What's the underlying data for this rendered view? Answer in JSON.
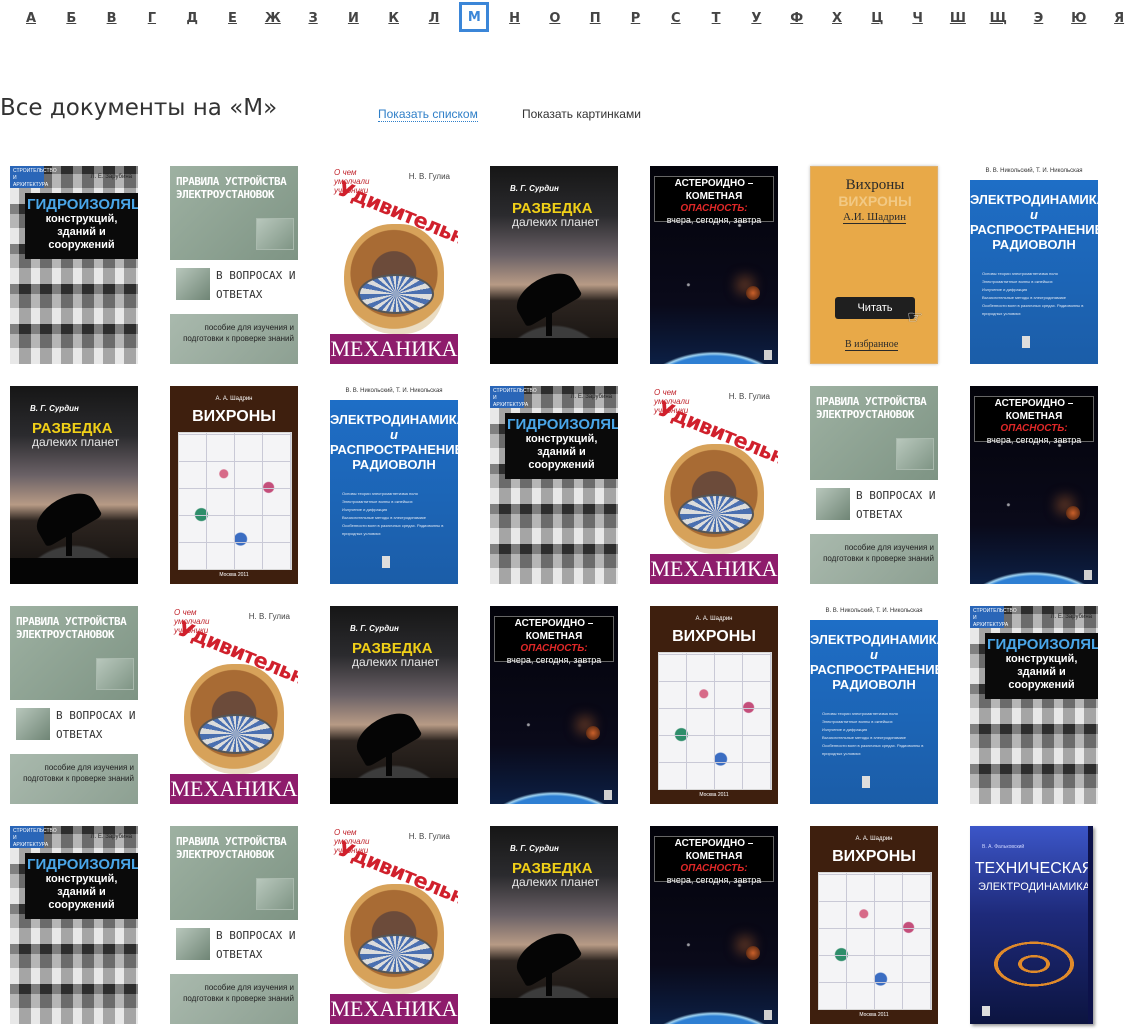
{
  "alphabet": {
    "letters": [
      "А",
      "Б",
      "В",
      "Г",
      "Д",
      "Е",
      "Ж",
      "З",
      "И",
      "К",
      "Л",
      "М",
      "Н",
      "О",
      "П",
      "Р",
      "С",
      "Т",
      "У",
      "Ф",
      "Х",
      "Ц",
      "Ч",
      "Ш",
      "Щ",
      "Э",
      "Ю",
      "Я"
    ],
    "active": "М"
  },
  "heading": {
    "title": "Все документы на «М»",
    "show_list": "Показать списком",
    "show_pictures": "Показать картинками"
  },
  "hover": {
    "read_button": "Читать",
    "favorite_link": "В избранное"
  },
  "covers": {
    "gidro": {
      "series": "СТРОИТЕЛЬСТВО И АРХИТЕКТУРА",
      "author": "Л. Е. Зарубина",
      "title_main": "ГИДРОИЗОЛЯЦИЯ",
      "title_rest": "конструкций, зданий и сооружений"
    },
    "pravila": {
      "title": "ПРАВИЛА УСТРОЙСТВА ЭЛЕКТРОУСТАНОВОК",
      "answers": "В ВОПРОСАХ И ОТВЕТАХ",
      "subtitle": "пособие для изучения и подготовки к проверке знаний"
    },
    "meh": {
      "series": "О чем умолчали учебники",
      "author": "Н. В. Гулиа",
      "title_arc": "Удивительная",
      "title_main": "МЕХАНИКА"
    },
    "razv": {
      "author": "В. Г. Сурдин",
      "title_main": "РАЗВЕДКА",
      "title_sub": "далеких планет"
    },
    "aster": {
      "line1": "АСТЕРОИДНО – КОМЕТНАЯ",
      "line2": "ОПАСНОСТЬ:",
      "line3": "вчера, сегодня, завтра"
    },
    "vihr": {
      "author": "А. А. Шадрин",
      "title": "ВИХРОНЫ",
      "hover_title": "Вихроны",
      "hover_author": "А.И. Шадрин",
      "city": "Москва 2011"
    },
    "electro": {
      "authors": "В. В. Никольский, Т. И. Никольская",
      "title1": "ЭЛЕКТРОДИНАМИКА",
      "title_and": "и",
      "title2": "РАСПРОСТРАНЕНИЕ",
      "title3": "РАДИОВОЛН",
      "items": [
        "Основы теории электромагнетизма поля",
        "Электромагнитные волны в окнейших",
        "Излучение и дифракция",
        "Вычислительные методы в электродинамике",
        "Особенности волн в различных средах. Радиоволны в природных условиях"
      ]
    },
    "tech": {
      "author": "В. А. Фальковский",
      "title1": "ТЕХНИЧЕСКАЯ",
      "title2": "ЭЛЕКТРОДИНАМИКА"
    }
  },
  "grid": {
    "rows": [
      [
        "gidro",
        "pravila",
        "meh",
        "razv",
        "aster",
        "vihr-hover",
        "electro"
      ],
      [
        "razv",
        "vihr",
        "electro",
        "gidro",
        "meh",
        "pravila",
        "aster"
      ],
      [
        "pravila",
        "meh",
        "razv",
        "aster",
        "vihr",
        "electro",
        "gidro"
      ],
      [
        "gidro",
        "pravila",
        "meh",
        "razv",
        "aster",
        "vihr",
        "tech"
      ]
    ],
    "hovered_cover": "vihr-hover"
  }
}
